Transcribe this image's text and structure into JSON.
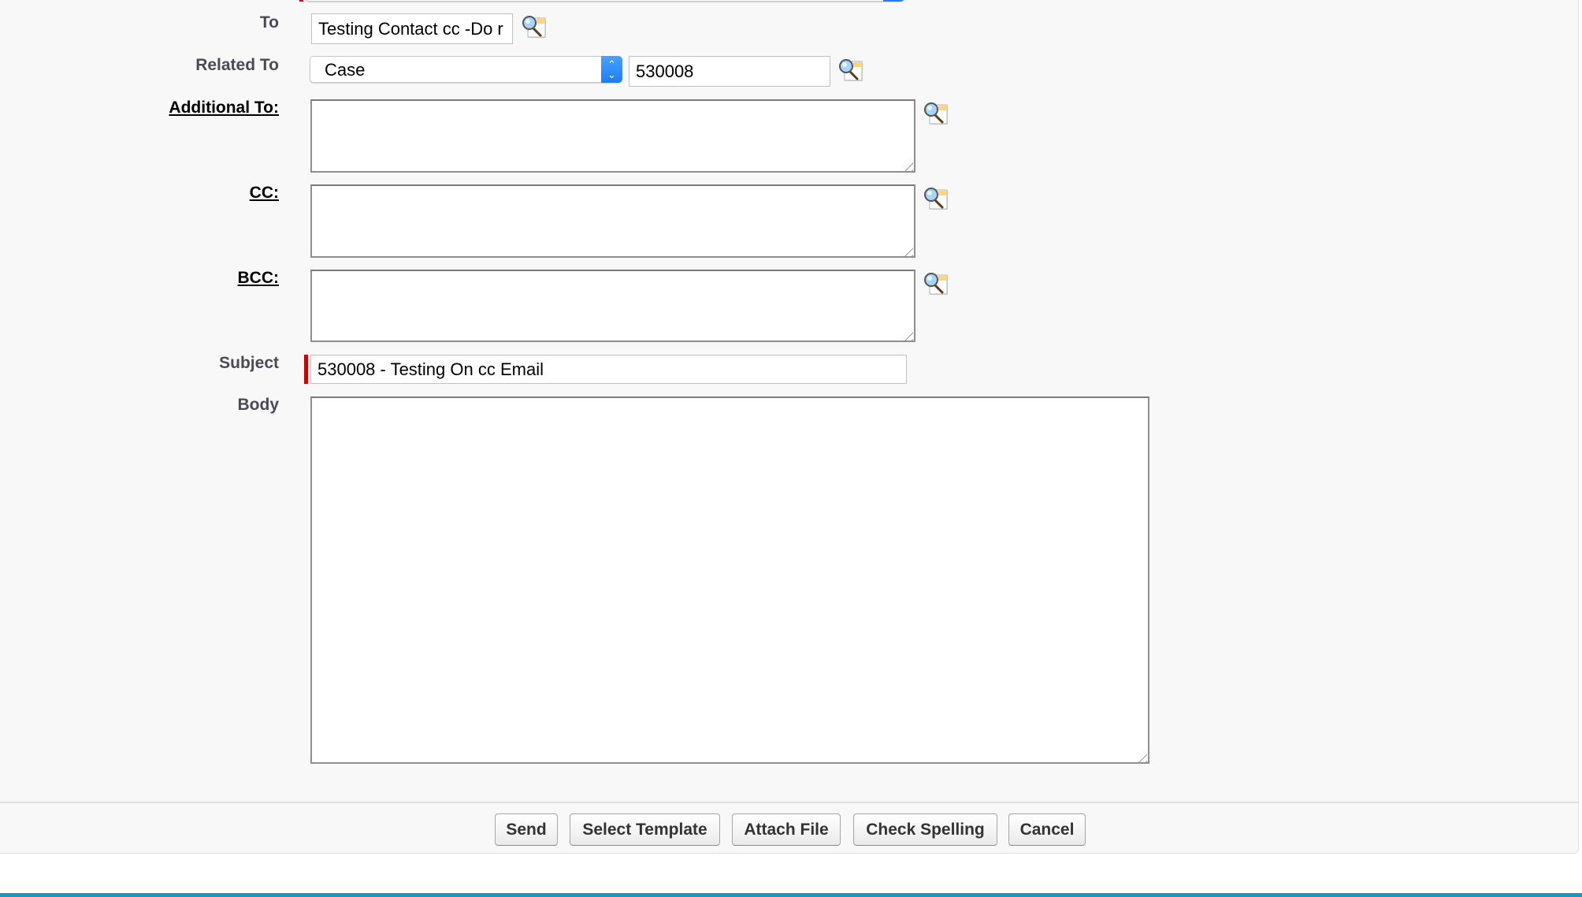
{
  "form": {
    "top_select": {
      "value": ""
    },
    "to": {
      "label": "To",
      "value": "Testing Contact cc -Do r"
    },
    "related_to": {
      "label": "Related To",
      "type_value": "Case",
      "record_value": "530008"
    },
    "additional_to": {
      "label": "Additional To:",
      "value": ""
    },
    "cc": {
      "label": "CC:",
      "value": ""
    },
    "bcc": {
      "label": "BCC:",
      "value": ""
    },
    "subject": {
      "label": "Subject",
      "value": "530008 - Testing On cc Email"
    },
    "body": {
      "label": "Body",
      "value": ""
    }
  },
  "icons": {
    "lookup": "lookup-magnifier-icon",
    "select_arrows": "up-down-chevron-icon"
  },
  "buttons": {
    "send": "Send",
    "select_template": "Select Template",
    "attach_file": "Attach File",
    "check_spelling": "Check Spelling",
    "cancel": "Cancel"
  },
  "colors": {
    "required": "#cc0000",
    "select_accent": "#1a7ef5",
    "bottom_bar": "#1798c1",
    "label": "#4a4a56"
  }
}
